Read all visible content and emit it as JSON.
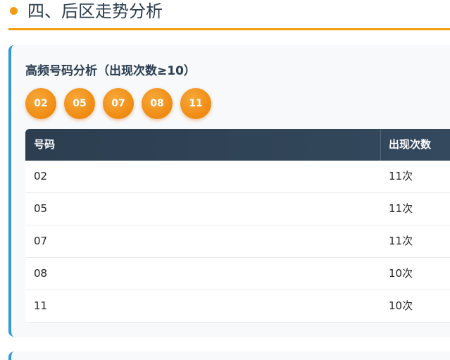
{
  "section": {
    "title": "四、后区走势分析"
  },
  "analysis": {
    "title": "高频号码分析（出现次数≥10）",
    "hot_numbers": [
      "02",
      "05",
      "07",
      "08",
      "11"
    ],
    "table": {
      "headers": [
        "号码",
        "出现次数"
      ],
      "rows": [
        [
          "02",
          "11次"
        ],
        [
          "05",
          "11次"
        ],
        [
          "07",
          "11次"
        ],
        [
          "08",
          "10次"
        ],
        [
          "11",
          "10次"
        ]
      ]
    }
  },
  "colors": {
    "accent": "#f39c12",
    "card_border": "#3498db",
    "header_bg": "#2c3e50",
    "ball": "#ef8a12"
  }
}
